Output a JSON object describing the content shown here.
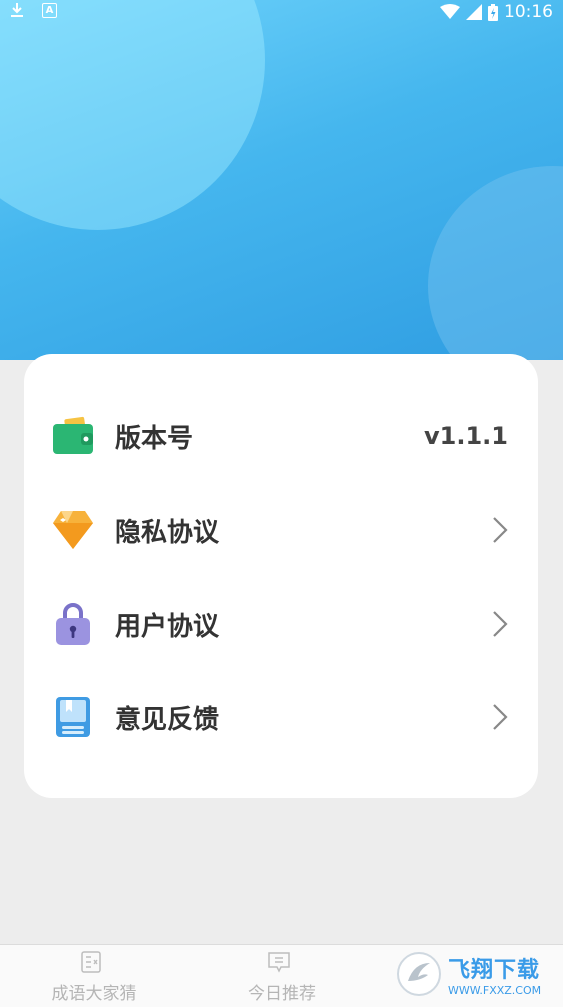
{
  "status_bar": {
    "time": "10:16",
    "left_icons": [
      "download-icon",
      "a-icon"
    ],
    "right_icons": [
      "wifi-icon",
      "signal-icon",
      "battery-icon"
    ]
  },
  "settings": {
    "items": [
      {
        "label": "版本号",
        "value": "v1.1.1",
        "icon": "wallet-icon"
      },
      {
        "label": "隐私协议",
        "icon": "diamond-icon"
      },
      {
        "label": "用户协议",
        "icon": "lock-icon"
      },
      {
        "label": "意见反馈",
        "icon": "notebook-icon"
      }
    ]
  },
  "tab_bar": {
    "tabs": [
      {
        "label": "成语大家猜",
        "icon": "idiom-icon"
      },
      {
        "label": "今日推荐",
        "icon": "recommend-icon"
      }
    ],
    "watermark": {
      "text": "飞翔下载",
      "sub": "WWW.FXXZ.COM"
    }
  },
  "colors": {
    "header_top": "#6fd3fb",
    "header_bottom": "#2f9de2",
    "background": "#ededed",
    "card": "#ffffff"
  }
}
